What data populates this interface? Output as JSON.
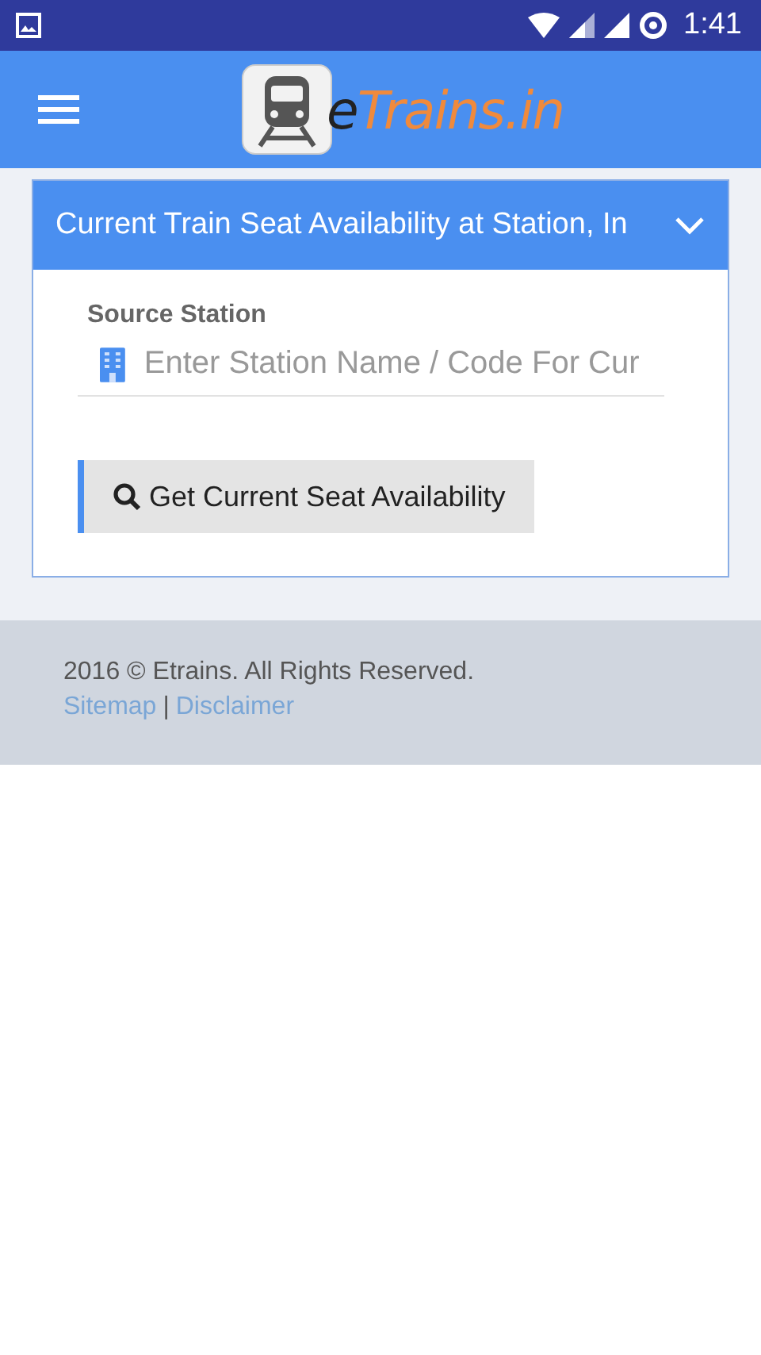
{
  "status_bar": {
    "time": "1:41"
  },
  "app_bar": {
    "logo": {
      "prefix": "e",
      "name": "Trains.in"
    }
  },
  "panel": {
    "title": "Current Train Seat Availability at Station, In",
    "field": {
      "label": "Source Station",
      "placeholder": "Enter Station Name / Code For Cur"
    },
    "button": "Get Current Seat Availability"
  },
  "footer": {
    "copyright": "2016 © Etrains. All Rights Reserved.",
    "links": [
      "Sitemap",
      "Disclaimer"
    ],
    "separator": "|"
  }
}
